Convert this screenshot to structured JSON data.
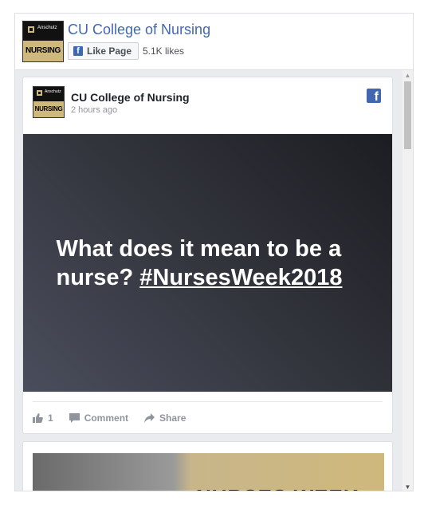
{
  "header": {
    "page_name": "CU College of Nursing",
    "like_button": "Like Page",
    "likes_count": "5.1K likes",
    "logo": {
      "small_text": "Anschutz",
      "word": "NURSING"
    }
  },
  "post": {
    "author": "CU College of Nursing",
    "time": "2 hours ago",
    "text_main": "What does it mean to be a nurse? ",
    "hashtag": "#NursesWeek2018",
    "like_count": "1",
    "comment_label": "Comment",
    "share_label": "Share"
  },
  "post2": {
    "image_text": "NURSES WEEK"
  },
  "colors": {
    "fb_blue": "#4267b2",
    "feed_bg": "#e9ebee",
    "gold": "#cfb87c"
  }
}
